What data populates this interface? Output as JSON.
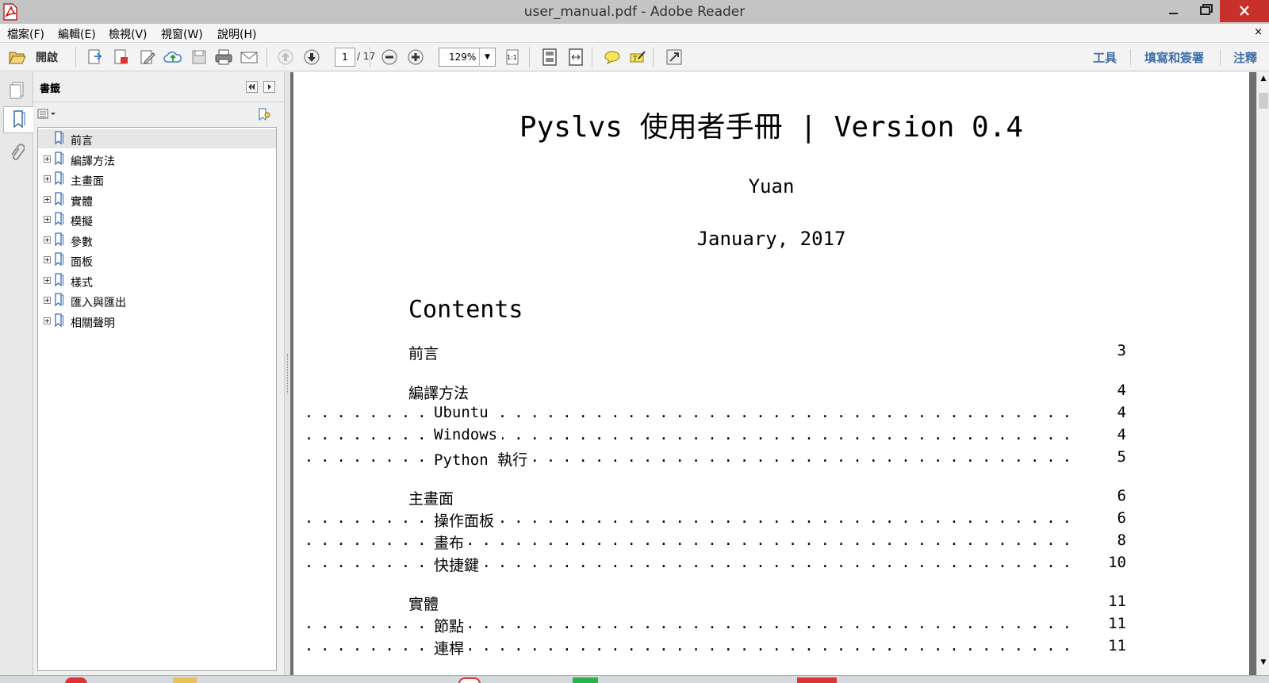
{
  "window": {
    "title": "user_manual.pdf - Adobe Reader",
    "close_color": "#c7302b"
  },
  "menu": {
    "items": [
      "檔案(F)",
      "編輯(E)",
      "檢視(V)",
      "視窗(W)",
      "說明(H)"
    ],
    "close_glyph": "×"
  },
  "toolbar": {
    "open_label": "開啟",
    "page_current": "1",
    "page_total": "/ 17",
    "zoom": "129%",
    "actual_size_label": "1:1",
    "links": [
      "工具",
      "填寫和簽署",
      "注釋"
    ],
    "link_color": "#3f6fa8"
  },
  "bookmarks": {
    "title": "書籤",
    "items": [
      {
        "label": "前言",
        "expandable": false,
        "selected": true
      },
      {
        "label": "編譯方法",
        "expandable": true
      },
      {
        "label": "主畫面",
        "expandable": true
      },
      {
        "label": "實體",
        "expandable": true
      },
      {
        "label": "模擬",
        "expandable": true
      },
      {
        "label": "參數",
        "expandable": true
      },
      {
        "label": "面板",
        "expandable": true
      },
      {
        "label": "樣式",
        "expandable": true
      },
      {
        "label": "匯入與匯出",
        "expandable": true
      },
      {
        "label": "相關聲明",
        "expandable": true
      }
    ]
  },
  "document": {
    "title": "Pyslvs 使用者手冊 | Version 0.4",
    "author": "Yuan",
    "date": "January, 2017",
    "contents_heading": "Contents",
    "toc": [
      {
        "label": "前言",
        "page": "3",
        "level": 0
      },
      {
        "label": "編譯方法",
        "page": "4",
        "level": 0
      },
      {
        "label": "Ubuntu",
        "page": "4",
        "level": 1
      },
      {
        "label": "Windows",
        "page": "4",
        "level": 1
      },
      {
        "label": "Python 執行",
        "page": "5",
        "level": 1
      },
      {
        "label": "主畫面",
        "page": "6",
        "level": 0
      },
      {
        "label": "操作面板",
        "page": "6",
        "level": 1
      },
      {
        "label": "畫布",
        "page": "8",
        "level": 1
      },
      {
        "label": "快捷鍵",
        "page": "10",
        "level": 1
      },
      {
        "label": "實體",
        "page": "11",
        "level": 0
      },
      {
        "label": "節點",
        "page": "11",
        "level": 1
      },
      {
        "label": "連桿",
        "page": "11",
        "level": 1
      }
    ]
  }
}
